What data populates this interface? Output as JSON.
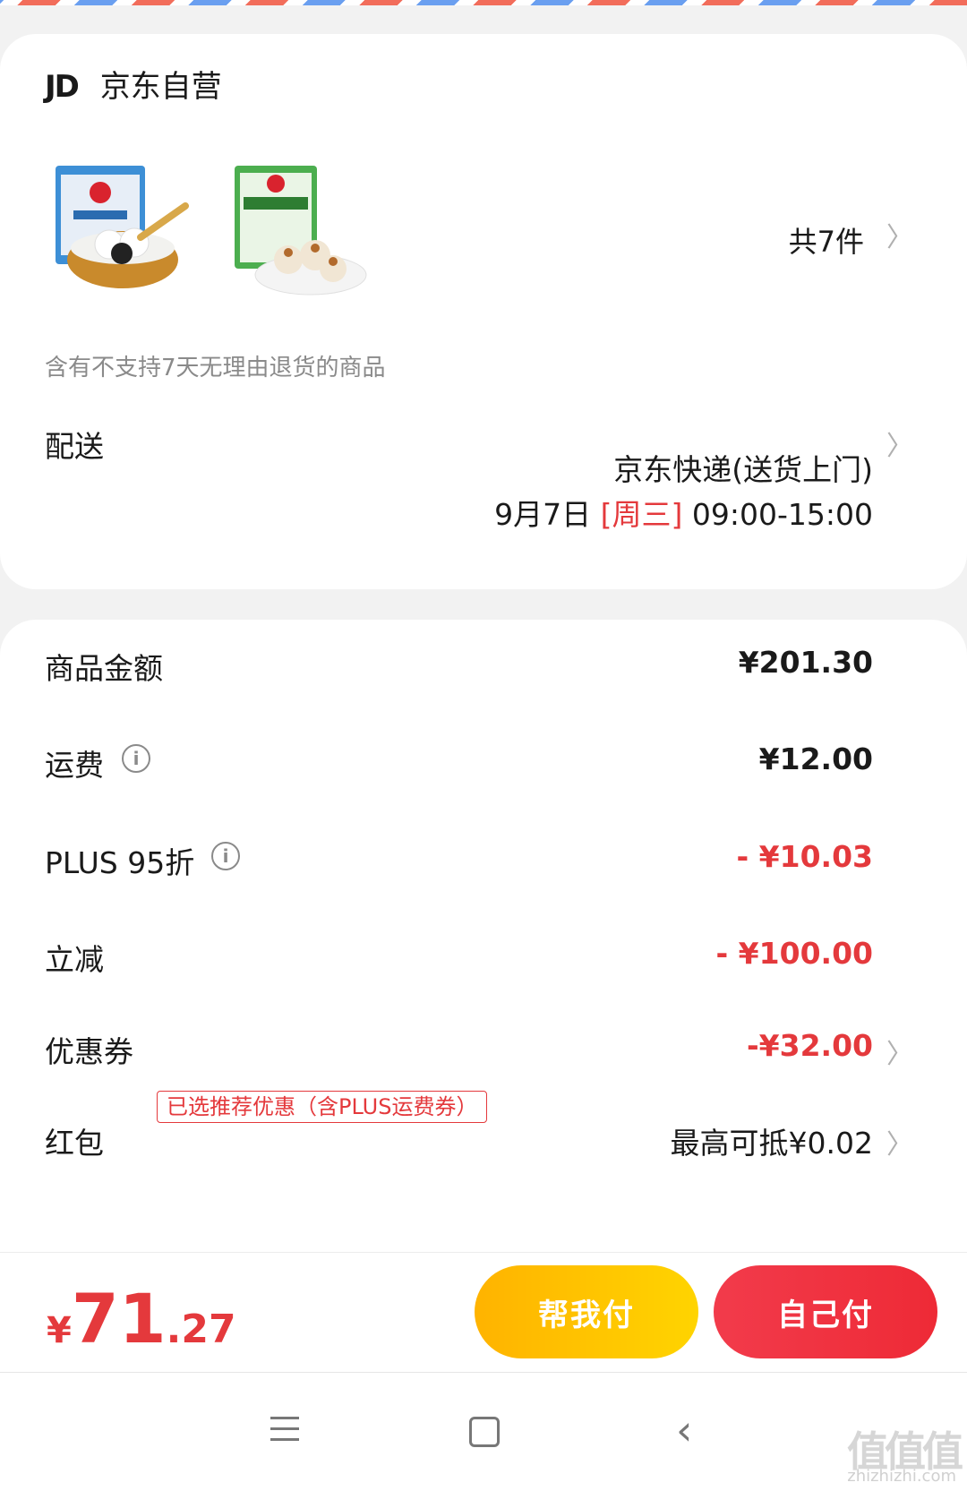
{
  "order": {
    "shop_logo": "JD",
    "shop_name": "京东自营",
    "item_count": "共7件",
    "return_note": "含有不支持7天无理由退货的商品",
    "delivery": {
      "label": "配送",
      "method": "京东快递(送货上门)",
      "date": "9月7日",
      "weekday": "[周三]",
      "time": "09:00-15:00"
    }
  },
  "products": [
    {
      "name": "黑芝麻汤圆",
      "icon": "tangyuan-product-image"
    },
    {
      "name": "糯米烧麦",
      "icon": "shaomai-product-image"
    }
  ],
  "summary": {
    "goods_label": "商品金额",
    "goods_value": "¥201.30",
    "shipping_label": "运费",
    "shipping_value": "¥12.00",
    "plus_label": "PLUS 95折",
    "plus_value": "- ¥10.03",
    "instant_label": "立减",
    "instant_value": "- ¥100.00",
    "coupon_label": "优惠券",
    "coupon_tag": "已选推荐优惠（含PLUS运费券）",
    "coupon_value": "-¥32.00",
    "redpacket_label": "红包",
    "redpacket_value": "最高可抵¥0.02"
  },
  "footer": {
    "total_symbol": "¥",
    "total_int": "71",
    "total_dec": ".27",
    "help_pay": "帮我付",
    "self_pay": "自己付"
  },
  "watermark": {
    "mark": "值值值",
    "site": "zhizhizhi.com"
  },
  "colors": {
    "accent_red": "#e4393c",
    "help_button": "#ffc107",
    "self_button": "#f23b4b"
  }
}
